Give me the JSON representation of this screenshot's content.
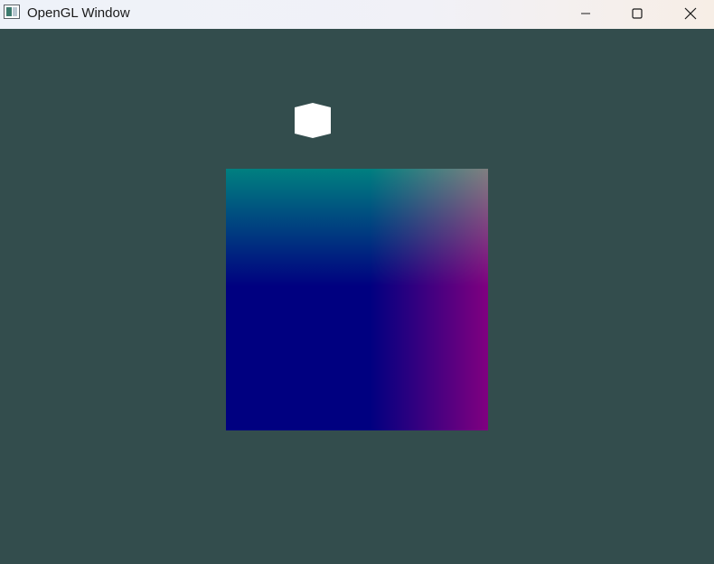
{
  "window": {
    "title": "OpenGL Window",
    "icon": "app-window-icon"
  },
  "controls": {
    "minimize_icon": "minimize-icon",
    "maximize_icon": "maximize-icon",
    "close_icon": "close-icon"
  },
  "scene": {
    "clear_color": "#334d4d",
    "light_cube_color": "#ffffff",
    "quad_corner_colors": {
      "top_left": "#008080",
      "top_right": "#808080",
      "bottom_left": "#000080",
      "bottom_right": "#800080"
    }
  }
}
